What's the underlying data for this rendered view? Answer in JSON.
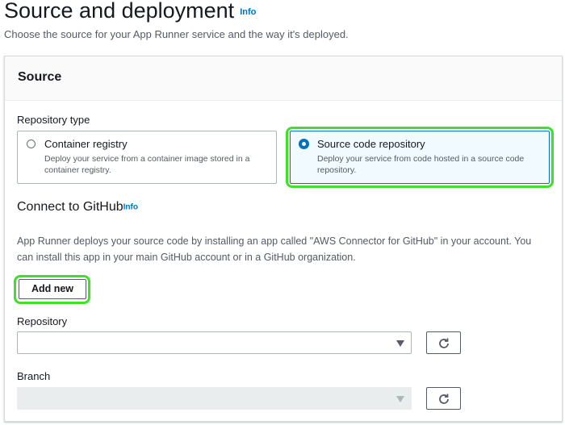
{
  "header": {
    "title": "Source and deployment",
    "info_link": "Info",
    "description": "Choose the source for your App Runner service and the way it's deployed."
  },
  "source_panel": {
    "title": "Source",
    "repository_type": {
      "label": "Repository type",
      "options": [
        {
          "title": "Container registry",
          "description": "Deploy your service from a container image stored in a container registry.",
          "selected": false
        },
        {
          "title": "Source code repository",
          "description": "Deploy your service from code hosted in a source code repository.",
          "selected": true
        }
      ]
    },
    "connect": {
      "title": "Connect to GitHub",
      "info_link": "Info",
      "description": "App Runner deploys your source code by installing an app called \"AWS Connector for GitHub\" in your account. You can install this app in your main GitHub account or in a GitHub organization.",
      "add_new_label": "Add new"
    },
    "repository": {
      "label": "Repository",
      "value": ""
    },
    "branch": {
      "label": "Branch",
      "value": "",
      "disabled": true
    }
  },
  "colors": {
    "highlight": "#3ee02a",
    "link": "#0073bb",
    "selected_tile_bg": "#f1faff"
  },
  "icons": {
    "refresh": "refresh-icon",
    "dropdown": "caret-down-icon"
  }
}
